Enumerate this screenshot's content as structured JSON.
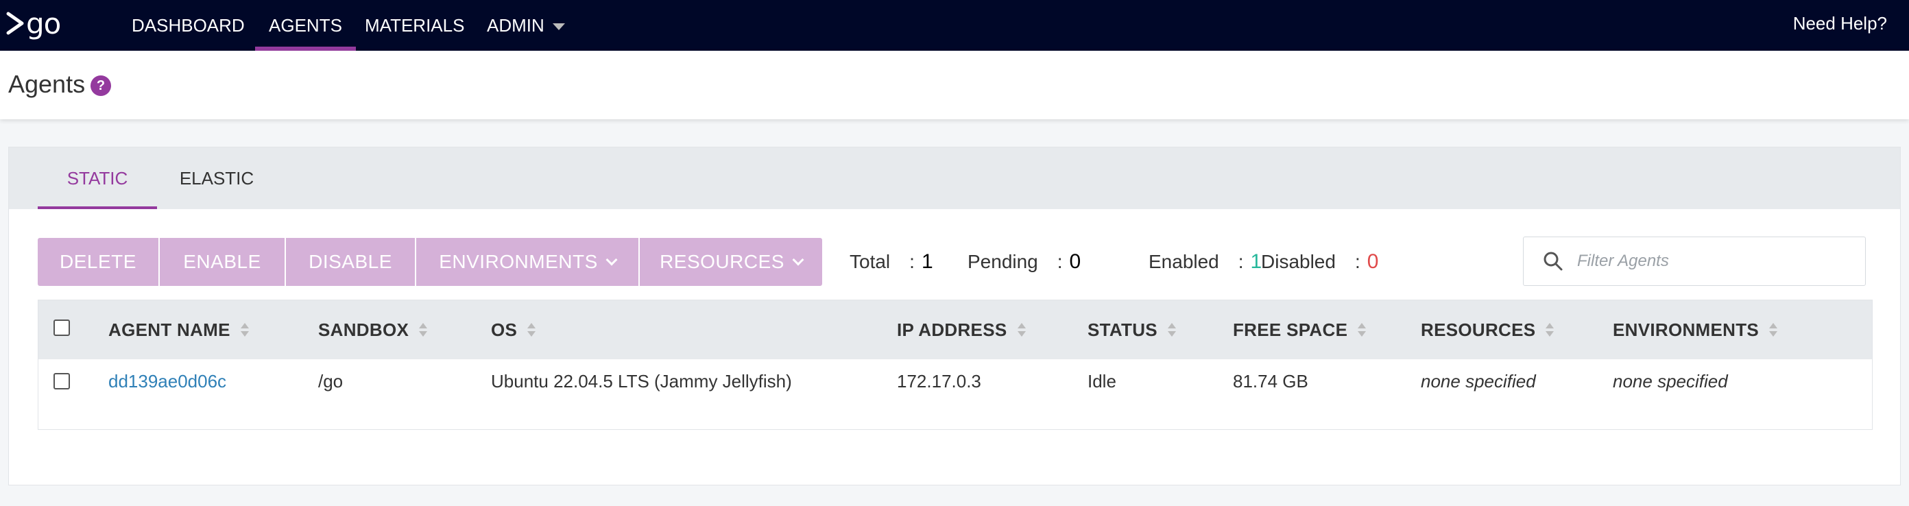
{
  "nav": {
    "logo_text": "go",
    "items": [
      {
        "label": "DASHBOARD",
        "active": false
      },
      {
        "label": "AGENTS",
        "active": true
      },
      {
        "label": "MATERIALS",
        "active": false
      },
      {
        "label": "ADMIN",
        "active": false
      }
    ],
    "help": "Need Help?"
  },
  "page": {
    "title": "Agents",
    "help_icon": "?"
  },
  "tabs": [
    {
      "label": "STATIC",
      "active": true
    },
    {
      "label": "ELASTIC",
      "active": false
    }
  ],
  "toolbar": {
    "delete": "DELETE",
    "enable": "ENABLE",
    "disable": "DISABLE",
    "environments": "ENVIRONMENTS",
    "resources": "RESOURCES"
  },
  "counts": {
    "total_label": "Total",
    "total": "1",
    "pending_label": "Pending",
    "pending": "0",
    "enabled_label": "Enabled",
    "enabled": "1",
    "disabled_label": "Disabled",
    "disabled": "0",
    "separator": ":"
  },
  "filter": {
    "placeholder": "Filter Agents"
  },
  "table": {
    "columns": [
      "AGENT NAME",
      "SANDBOX",
      "OS",
      "IP ADDRESS",
      "STATUS",
      "FREE SPACE",
      "RESOURCES",
      "ENVIRONMENTS"
    ],
    "rows": [
      {
        "agent_name": "dd139ae0d06c",
        "sandbox": "/go",
        "os": "Ubuntu 22.04.5 LTS (Jammy Jellyfish)",
        "ip_address": "172.17.0.3",
        "status": "Idle",
        "free_space": "81.74 GB",
        "resources": "none specified",
        "environments": "none specified"
      }
    ]
  },
  "colors": {
    "nav_bg": "#000728",
    "accent": "#943a9e",
    "button_bg": "#d5b1d8",
    "enabled": "#26b79a",
    "disabled": "#e04a4a",
    "link": "#2f80b7"
  }
}
